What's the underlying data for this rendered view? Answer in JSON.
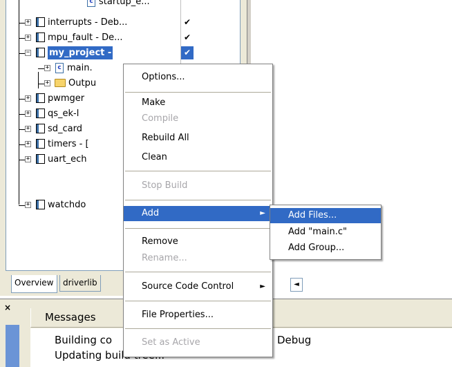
{
  "tree": {
    "partial_top": "startup_e...",
    "items": [
      {
        "label": "interrupts - Deb...",
        "check": "✔",
        "icon": "project-icon"
      },
      {
        "label": "mpu_fault - De...",
        "check": "✔",
        "icon": "project-icon"
      },
      {
        "label": "my_project -",
        "check": "✔",
        "icon": "project-icon",
        "selected": true
      },
      {
        "label": "main.",
        "icon": "c-file-icon"
      },
      {
        "label": "Outpu",
        "icon": "folder-icon"
      },
      {
        "label": "pwmger",
        "icon": "project-icon"
      },
      {
        "label": "qs_ek-l",
        "icon": "project-icon"
      },
      {
        "label": "sd_card",
        "icon": "project-icon"
      },
      {
        "label": "timers - [",
        "icon": "project-icon"
      },
      {
        "label": "uart_ech",
        "icon": "project-icon"
      },
      {
        "label": "watchdo",
        "icon": "project-icon"
      }
    ]
  },
  "tabs": [
    {
      "label": "Overview",
      "active": true
    },
    {
      "label": "driverlib"
    }
  ],
  "tab_scroll": "◄",
  "messages": {
    "close": "×",
    "title": "Messages",
    "line1_left": "Building co",
    "line1_right": "Debug",
    "line2": "Updating build tree..."
  },
  "context_menu": {
    "options": "Options...",
    "make": "Make",
    "compile": "Compile",
    "rebuild_all": "Rebuild All",
    "clean": "Clean",
    "stop_build": "Stop Build",
    "add": "Add",
    "remove": "Remove",
    "rename": "Rename...",
    "source_code_control": "Source Code Control",
    "file_properties": "File Properties...",
    "set_as_active": "Set as Active",
    "submenu_arrow": "►"
  },
  "submenu": {
    "add_files": "Add Files...",
    "add_main": "Add \"main.c\"",
    "add_group": "Add Group..."
  },
  "colors": {
    "selection": "#316ac5",
    "disabled_text": "#a7a6aa",
    "panel_bg": "#ece9d8"
  }
}
